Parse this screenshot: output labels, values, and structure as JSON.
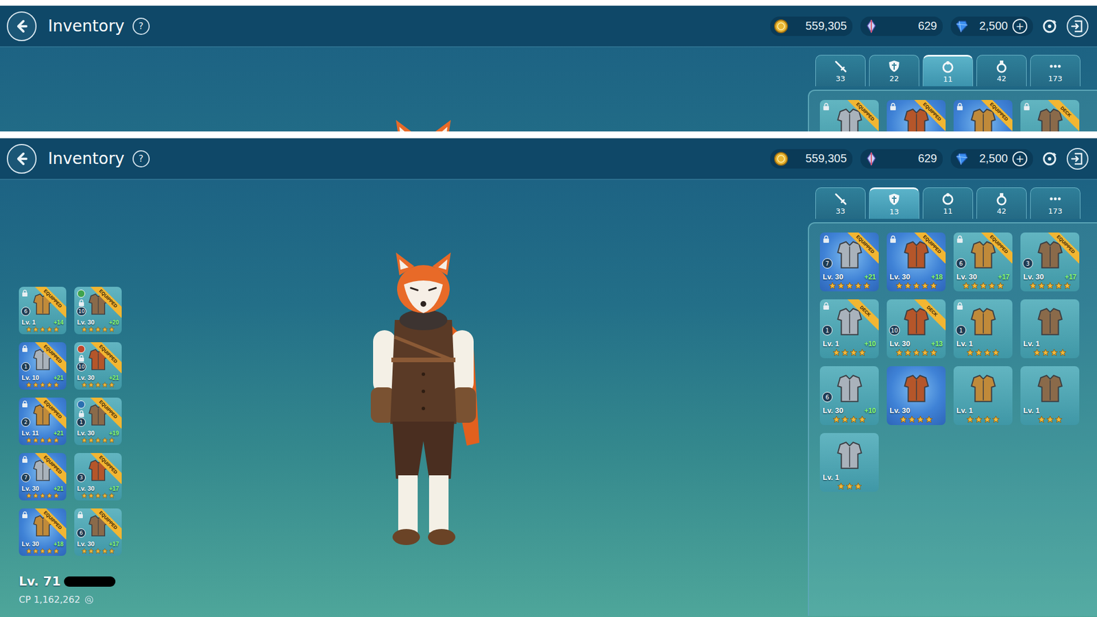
{
  "shots": [
    {
      "header": {
        "title": "Inventory",
        "help": "?",
        "gold": "559,305",
        "crystals": "629",
        "gems": "2,500",
        "add": "+"
      },
      "tabs": [
        {
          "count": "33",
          "selected": false
        },
        {
          "count": "22",
          "selected": false
        },
        {
          "count": "11",
          "selected": true
        },
        {
          "count": "42",
          "selected": false
        },
        {
          "count": "173",
          "selected": false
        }
      ],
      "items": [
        {
          "badge": "EQUIPPED",
          "locked": true,
          "highlight": false
        },
        {
          "badge": "EQUIPPED",
          "locked": true,
          "highlight": true
        },
        {
          "badge": "EQUIPPED",
          "locked": true,
          "highlight": true
        },
        {
          "badge": "DECK",
          "locked": true,
          "highlight": false
        }
      ],
      "equipped": []
    },
    {
      "header": {
        "title": "Inventory",
        "help": "?",
        "gold": "559,305",
        "crystals": "629",
        "gems": "2,500",
        "add": "+"
      },
      "tabs": [
        {
          "count": "33",
          "selected": false
        },
        {
          "count": "13",
          "selected": true
        },
        {
          "count": "11",
          "selected": false
        },
        {
          "count": "42",
          "selected": false
        },
        {
          "count": "173",
          "selected": false
        }
      ],
      "items": [
        {
          "badge": "EQUIPPED",
          "locked": true,
          "highlight": true,
          "enhance": "7",
          "level": "Lv. 30",
          "bonus": "+21",
          "stars": 5
        },
        {
          "badge": "EQUIPPED",
          "locked": true,
          "highlight": true,
          "enhance": "",
          "level": "Lv. 30",
          "bonus": "+18",
          "stars": 5
        },
        {
          "badge": "EQUIPPED",
          "locked": true,
          "highlight": false,
          "enhance": "6",
          "level": "Lv. 30",
          "bonus": "+17",
          "stars": 5
        },
        {
          "badge": "EQUIPPED",
          "locked": false,
          "highlight": false,
          "enhance": "3",
          "level": "Lv. 30",
          "bonus": "+17",
          "stars": 5
        },
        {
          "badge": "DECK",
          "locked": true,
          "highlight": false,
          "enhance": "1",
          "level": "Lv. 1",
          "bonus": "+10",
          "stars": 4
        },
        {
          "badge": "DECK",
          "locked": false,
          "highlight": false,
          "enhance": "10",
          "level": "Lv. 30",
          "bonus": "+13",
          "stars": 5
        },
        {
          "badge": "",
          "locked": true,
          "highlight": false,
          "enhance": "1",
          "level": "Lv. 1",
          "bonus": "",
          "stars": 4
        },
        {
          "badge": "",
          "locked": false,
          "highlight": false,
          "enhance": "",
          "level": "Lv. 1",
          "bonus": "",
          "stars": 4
        },
        {
          "badge": "",
          "locked": false,
          "highlight": false,
          "enhance": "6",
          "level": "Lv. 30",
          "bonus": "+10",
          "stars": 4
        },
        {
          "badge": "",
          "locked": false,
          "highlight": true,
          "enhance": "",
          "level": "Lv. 30",
          "bonus": "",
          "stars": 4
        },
        {
          "badge": "",
          "locked": false,
          "highlight": false,
          "enhance": "",
          "level": "Lv. 1",
          "bonus": "",
          "stars": 4
        },
        {
          "badge": "",
          "locked": false,
          "highlight": false,
          "enhance": "",
          "level": "Lv. 1",
          "bonus": "",
          "stars": 3
        },
        {
          "badge": "",
          "locked": false,
          "highlight": false,
          "enhance": "",
          "level": "Lv. 1",
          "bonus": "",
          "stars": 3
        }
      ],
      "equipped": [
        {
          "badge": "EQUIPPED",
          "locked": true,
          "highlight": false,
          "color": "",
          "enhance": "6",
          "level": "Lv. 1",
          "bonus": "+14",
          "stars": 5
        },
        {
          "badge": "EQUIPPED",
          "locked": true,
          "highlight": false,
          "color": "#3fa34d",
          "enhance": "10",
          "level": "Lv. 30",
          "bonus": "+20",
          "stars": 5
        },
        {
          "badge": "EQUIPPED",
          "locked": true,
          "highlight": true,
          "color": "",
          "enhance": "1",
          "level": "Lv. 10",
          "bonus": "+21",
          "stars": 5
        },
        {
          "badge": "EQUIPPED",
          "locked": true,
          "highlight": false,
          "color": "#c0452a",
          "enhance": "10",
          "level": "Lv. 30",
          "bonus": "+21",
          "stars": 5
        },
        {
          "badge": "EQUIPPED",
          "locked": true,
          "highlight": true,
          "color": "",
          "enhance": "2",
          "level": "Lv. 11",
          "bonus": "+21",
          "stars": 5
        },
        {
          "badge": "EQUIPPED",
          "locked": true,
          "highlight": false,
          "color": "#2a6fb0",
          "enhance": "1",
          "level": "Lv. 30",
          "bonus": "+19",
          "stars": 5
        },
        {
          "badge": "EQUIPPED",
          "locked": true,
          "highlight": true,
          "color": "",
          "enhance": "7",
          "level": "Lv. 30",
          "bonus": "+21",
          "stars": 5
        },
        {
          "badge": "EQUIPPED",
          "locked": false,
          "highlight": false,
          "color": "",
          "enhance": "3",
          "level": "Lv. 30",
          "bonus": "+17",
          "stars": 5
        },
        {
          "badge": "EQUIPPED",
          "locked": true,
          "highlight": true,
          "color": "",
          "enhance": "",
          "level": "Lv. 30",
          "bonus": "+18",
          "stars": 5
        },
        {
          "badge": "EQUIPPED",
          "locked": true,
          "highlight": false,
          "color": "",
          "enhance": "6",
          "level": "Lv. 30",
          "bonus": "+17",
          "stars": 5
        }
      ],
      "player": {
        "level": "Lv. 71",
        "name_hidden": true,
        "cp": "CP 1,162,262"
      }
    }
  ]
}
